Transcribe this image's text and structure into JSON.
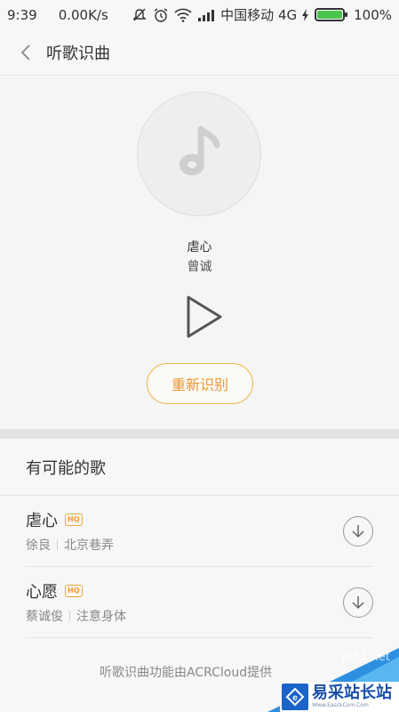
{
  "status_bar": {
    "time": "9:39",
    "speed": "0.00K/s",
    "carrier": "中国移动 4G",
    "battery": "100%",
    "icons": [
      "mute-icon",
      "alarm-icon",
      "wifi-icon",
      "signal-icon",
      "charging-icon",
      "battery-icon"
    ]
  },
  "header": {
    "title": "听歌识曲",
    "back_icon": "chevron-left-icon"
  },
  "result": {
    "song_title": "虐心",
    "artist": "曾诚",
    "retry_label": "重新识别",
    "disc_icon": "music-note-icon",
    "play_icon": "play-icon"
  },
  "possible_songs": {
    "title": "有可能的歌",
    "items": [
      {
        "title": "虐心",
        "badge": "HQ",
        "artist": "徐良",
        "album": "北京巷弄"
      },
      {
        "title": "心愿",
        "badge": "HQ",
        "artist": "蔡诚俊",
        "album": "注意身体"
      }
    ]
  },
  "footer": {
    "note": "听歌识曲功能由ACRCloud提供"
  },
  "watermark": {
    "brand": "易采站长站",
    "url": "Www.EasckCom.Com",
    "domain": "jb51.net"
  },
  "colors": {
    "accent": "#f0942e",
    "accent_border": "#f2b552",
    "battery": "#4cc34c",
    "watermark_blue": "#1a64c8"
  }
}
